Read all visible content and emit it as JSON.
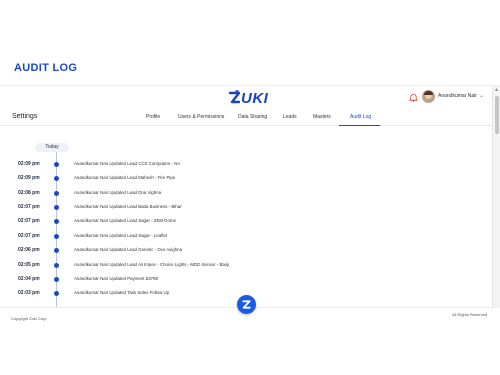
{
  "page": {
    "heading": "AUDIT LOG"
  },
  "header": {
    "logo_text": "UKI",
    "user_name": "Anandkumar Nair",
    "caret": "⌄"
  },
  "nav": {
    "settings_title": "Settings",
    "tabs": [
      {
        "label": "Profile"
      },
      {
        "label": "Users & Permissions"
      },
      {
        "label": "Data Sharing"
      },
      {
        "label": "Leads"
      },
      {
        "label": "Masters"
      },
      {
        "label": "Audit Log",
        "active": true
      }
    ]
  },
  "timeline": {
    "group_label": "Today",
    "entries": [
      {
        "time": "02:09 pm",
        "text": "Anandkumar Nair Updated Lead CCS Computers - NA"
      },
      {
        "time": "02:09 pm",
        "text": "Anandkumar Nair Updated Lead Mahesh - Fire Pipe"
      },
      {
        "time": "02:08 pm",
        "text": "Anandkumar Nair Updated Lead Dna Vighna"
      },
      {
        "time": "02:07 pm",
        "text": "Anandkumar Nair Updated Lead Bada Business - Bihar"
      },
      {
        "time": "02:07 pm",
        "text": "Anandkumar Nair Updated Lead Sagar - ZEM Dome"
      },
      {
        "time": "02:07 pm",
        "text": "Anandkumar Nair Updated Lead Sagar - Leaflet"
      },
      {
        "time": "02:06 pm",
        "text": "Anandkumar Nair Updated Lead Genetic - Oxo Avighna"
      },
      {
        "time": "02:05 pm",
        "text": "Anandkumar Nair Updated Lead Ali Impex - Choice Lights - MDD Sensor - Banji"
      },
      {
        "time": "02:04 pm",
        "text": "Anandkumar Nair Updated Payment 53789"
      },
      {
        "time": "02:03 pm",
        "text": "Anandkumar Nair Updated Task Sales Follow Up"
      }
    ]
  },
  "footer": {
    "copyright": "Copyright Zuki Corp",
    "rights": "All Rights Reserved"
  },
  "colors": {
    "accent": "#1a49c6",
    "fab": "#1b5be0"
  }
}
